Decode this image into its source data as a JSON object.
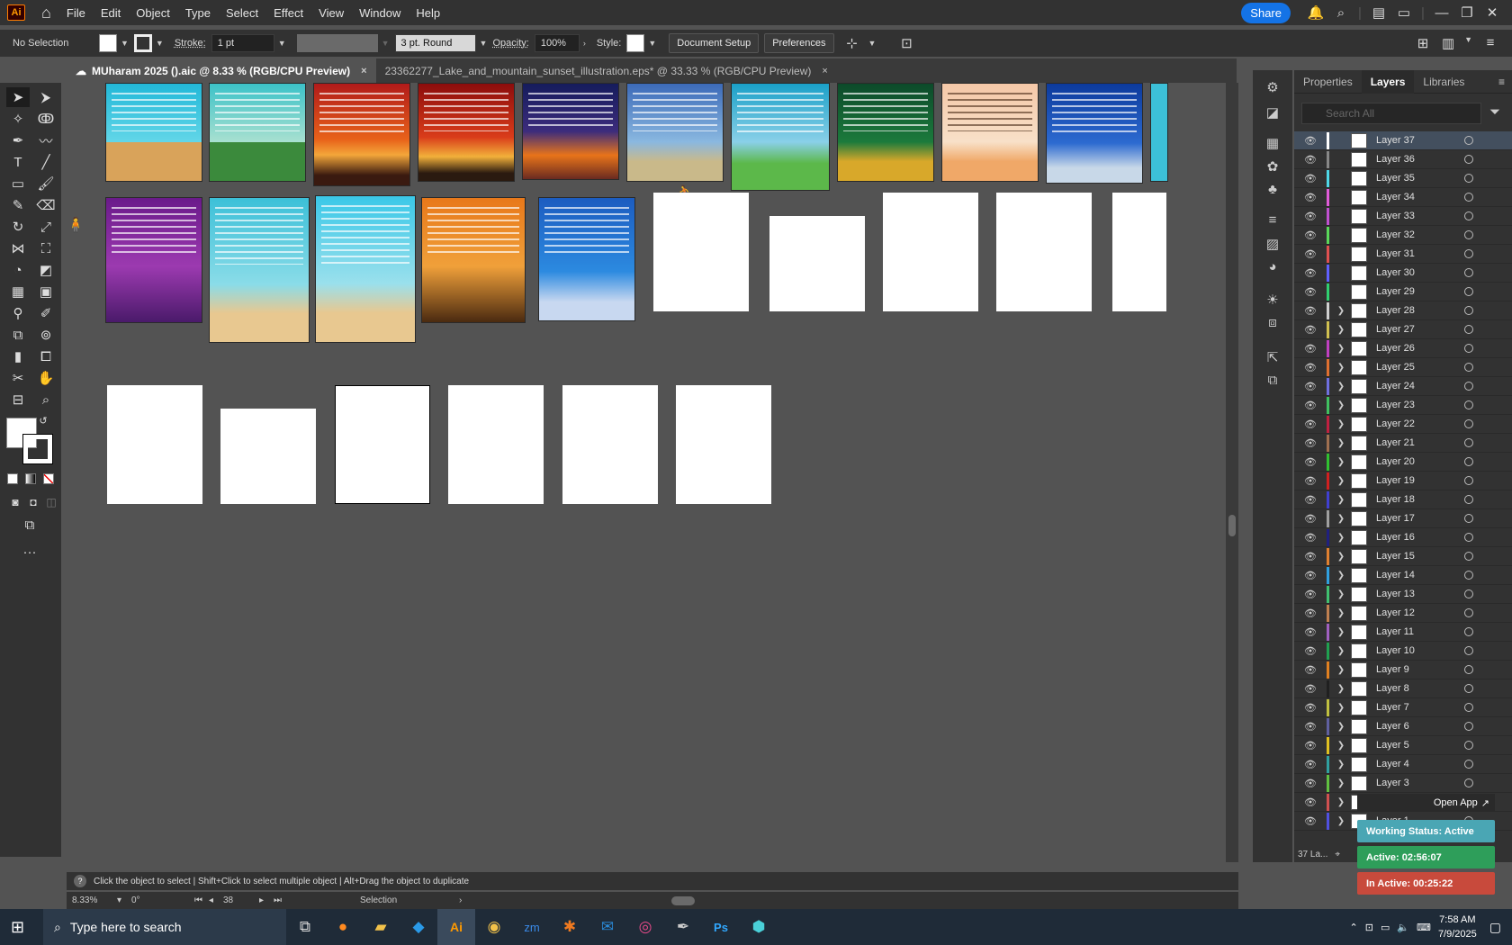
{
  "menubar": {
    "logo": "Ai",
    "items": [
      "File",
      "Edit",
      "Object",
      "Type",
      "Select",
      "Effect",
      "View",
      "Window",
      "Help"
    ],
    "share": "Share"
  },
  "control": {
    "selection": "No Selection",
    "stroke_label": "Stroke:",
    "stroke_value": "1 pt",
    "brush": "3 pt. Round",
    "opacity_label": "Opacity:",
    "opacity_value": "100%",
    "style_label": "Style:",
    "doc_setup": "Document Setup",
    "preferences": "Preferences"
  },
  "tabs": [
    {
      "label": "MUharam 2025 ().aic @ 8.33 % (RGB/CPU Preview)",
      "close": "×"
    },
    {
      "label": "23362277_Lake_and_mountain_sunset_illustration.eps* @ 33.33 % (RGB/CPU Preview)",
      "close": "×"
    }
  ],
  "panel": {
    "tabs": [
      "Properties",
      "Layers",
      "Libraries"
    ],
    "search_placeholder": "Search All",
    "layers": [
      "Layer 37",
      "Layer 36",
      "Layer 35",
      "Layer 34",
      "Layer 33",
      "Layer 32",
      "Layer 31",
      "Layer 30",
      "Layer 29",
      "Layer 28",
      "Layer 27",
      "Layer 26",
      "Layer 25",
      "Layer 24",
      "Layer 23",
      "Layer 22",
      "Layer 21",
      "Layer 20",
      "Layer 19",
      "Layer 18",
      "Layer 17",
      "Layer 16",
      "Layer 15",
      "Layer 14",
      "Layer 13",
      "Layer 12",
      "Layer 11",
      "Layer 10",
      "Layer 9",
      "Layer 8",
      "Layer 7",
      "Layer 6",
      "Layer 5",
      "Layer 4",
      "Layer 3",
      "Layer 2",
      "Layer 1"
    ],
    "layer_colors": [
      "#ffffff",
      "#888888",
      "#4fd8e8",
      "#e05bd8",
      "#c050d0",
      "#5ad85a",
      "#e05050",
      "#6060ff",
      "#30d070",
      "#d0d0d0",
      "#d0c050",
      "#c040c0",
      "#e07030",
      "#7070e0",
      "#40c060",
      "#c02040",
      "#a07050",
      "#30c030",
      "#d02020",
      "#4040d0",
      "#a0a0a0",
      "#202080",
      "#e08030",
      "#30a0e0",
      "#40c070",
      "#c08050",
      "#a060c0",
      "#20a050",
      "#e08020",
      "#202020",
      "#c0c040",
      "#6060a0",
      "#e0c020",
      "#30a0a0",
      "#60c040",
      "#d05050",
      "#5050e0"
    ],
    "footer_count": "37 La...",
    "open_app": "Open App",
    "working_status": "Working Status: Active",
    "active_time": "Active: 02:56:07",
    "inactive_time": "In Active: 00:25:22"
  },
  "statusbar": {
    "hint": "Click the object to select  |  Shift+Click to select multiple object  |  Alt+Drag the object to duplicate",
    "zoom": "8.33%",
    "rotation": "0°",
    "artboard": "38",
    "tool": "Selection"
  },
  "taskbar": {
    "search_placeholder": "Type here to search",
    "time": "7:58 AM",
    "date": "7/9/2025"
  },
  "colors": {
    "accent": "#1473e6",
    "active_green": "#2e9e5a",
    "inactive_red": "#c84a3c",
    "working_teal": "#4aa6b4"
  }
}
